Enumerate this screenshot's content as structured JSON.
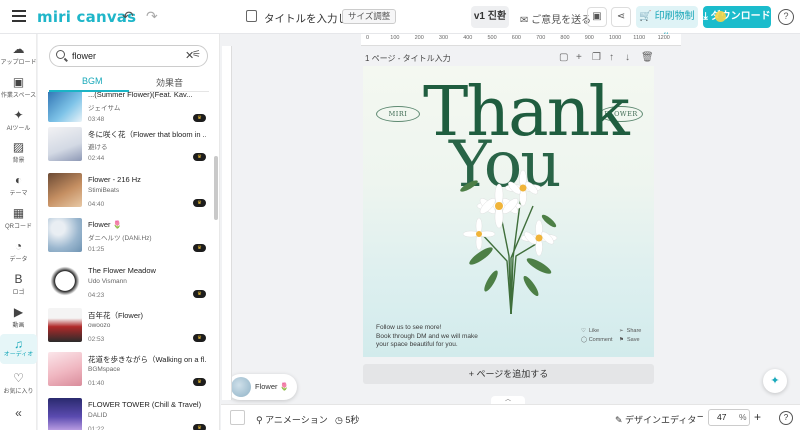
{
  "header": {
    "logo": "miri canvas",
    "undo": "↶",
    "redo": "↷",
    "doc_title": "タイトルを入力して...",
    "size_btn": "サイズ調整",
    "version": "v1 진환",
    "feedback": "ご意見を送る",
    "print": "印刷物制作",
    "download": "ダウンロード",
    "help": "?"
  },
  "rail": [
    {
      "icon": "☁",
      "label": "アップロード",
      "name": "upload"
    },
    {
      "icon": "▣",
      "label": "作業スペース",
      "name": "workspace"
    },
    {
      "icon": "✦",
      "label": "AIツール",
      "name": "ai-tools"
    },
    {
      "icon": "▨",
      "label": "背景",
      "name": "background"
    },
    {
      "icon": "◐",
      "label": "テーマ",
      "name": "theme"
    },
    {
      "icon": "▦",
      "label": "QRコード",
      "name": "qr-code"
    },
    {
      "icon": "◔",
      "label": "データ",
      "name": "data"
    },
    {
      "icon": "B",
      "label": "ロゴ",
      "name": "logo"
    },
    {
      "icon": "▶",
      "label": "動画",
      "name": "video"
    },
    {
      "icon": "♫",
      "label": "オーディオ",
      "name": "audio"
    },
    {
      "icon": "♡",
      "label": "お気に入り",
      "name": "favorites"
    },
    {
      "icon": "«",
      "label": "",
      "name": "collapse"
    }
  ],
  "panel": {
    "search_value": "flower",
    "clear": "✕",
    "filter": "⚟",
    "tabs": [
      "BGM",
      "効果音"
    ],
    "tracks": [
      {
        "title": "...(Summer Flower)(Feat. Kav...",
        "artist": "ジェイサム",
        "time": "03:48",
        "premium": "♛"
      },
      {
        "title": "冬に咲く花（Flower that bloom in ...",
        "artist": "避ける",
        "time": "02:44",
        "premium": "♛"
      },
      {
        "title": "Flower - 216 Hz",
        "artist": "StimiBeats",
        "time": "04:40",
        "premium": "♛"
      },
      {
        "title": "Flower 🌷",
        "artist": "ダニヘルツ (DANi.Hz)",
        "time": "01:25",
        "premium": "♛"
      },
      {
        "title": "The Flower Meadow",
        "artist": "Udo Vismann",
        "time": "04:23",
        "premium": "♛"
      },
      {
        "title": "百年花（Flower)",
        "artist": "owoozo",
        "time": "02:53",
        "premium": "♛"
      },
      {
        "title": "花道を歩きながら（Walking on a fl...",
        "artist": "BGMspace",
        "time": "01:40",
        "premium": "♛"
      },
      {
        "title": "FLOWER TOWER (Chill & Travel)",
        "artist": "DALID",
        "time": "01:22",
        "premium": "♛"
      }
    ],
    "now_playing": "Flower 🌷"
  },
  "canvas": {
    "ruler_ticks": [
      "0",
      "100",
      "200",
      "300",
      "400",
      "500",
      "600",
      "700",
      "800",
      "900",
      "1000",
      "1100",
      "1200"
    ],
    "page_label": "1 ページ - タイトル入力",
    "add_page": "+ ページを追加する",
    "art": {
      "thank": "Thank",
      "you": "You",
      "left_oval": "MIRI",
      "right_oval": "FLOWER",
      "follow_lines": [
        "Follow us to see more!",
        "Book through DM and we will make",
        "your space beautiful for you."
      ],
      "actions": [
        "Like",
        "Share",
        "Comment",
        "Save"
      ]
    }
  },
  "bottom": {
    "animation": "アニメーション",
    "duration": "5秒",
    "design_editor": "デザインエディタ",
    "zoom_minus": "−",
    "zoom": "47",
    "zoom_unit": "%",
    "zoom_plus": "+",
    "help": "?"
  }
}
